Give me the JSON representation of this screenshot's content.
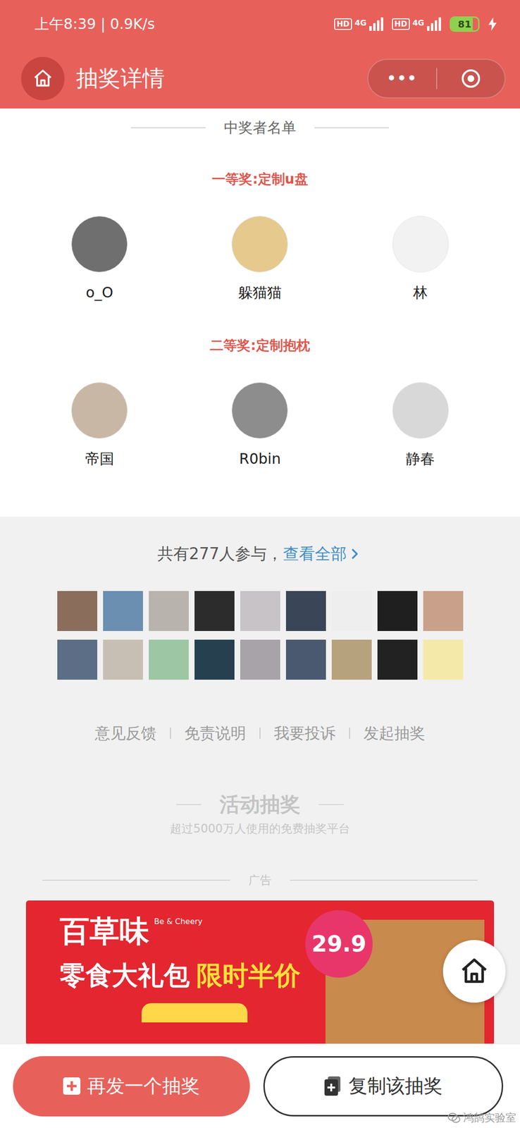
{
  "status_bar": {
    "time": "上午8:39 | 0.9K/s",
    "sims": [
      {
        "badge": "HD",
        "network": "4G",
        "level": 1
      },
      {
        "badge": "HD",
        "network": "4G",
        "level": 1
      }
    ],
    "battery": {
      "reading": "81",
      "level": 0.81,
      "charging": true
    }
  },
  "header": {
    "title": "抽奖详情",
    "menu": "•••"
  },
  "winners": {
    "title": "中奖者名单",
    "prizes": [
      {
        "label": "一等奖:定制u盘",
        "names": [
          "o_O",
          "躲猫猫",
          "林"
        ]
      },
      {
        "label": "二等奖:定制抱枕",
        "names": [
          "帝国",
          "R0bin",
          "静春"
        ]
      }
    ]
  },
  "participants": {
    "summary": "共有277人参与，",
    "link": "查看全部",
    "shown": 18
  },
  "footer_links": [
    "意见反馈",
    "免责说明",
    "我要投诉",
    "发起抽奖"
  ],
  "brand": {
    "title": "活动抽奖",
    "subtitle": "超过5000万人使用的免费抽奖平台"
  },
  "ad": {
    "label": "广告",
    "brand": "百草味",
    "brand_en": "Be & Cheery",
    "headline": "零食大礼包",
    "highlight": "限时半价",
    "price": "29.9"
  },
  "actions": [
    {
      "label": "再发一个抽奖",
      "primary": true
    },
    {
      "label": "复制该抽奖",
      "primary": false
    }
  ],
  "watermark": "鸿鹄实验室"
}
